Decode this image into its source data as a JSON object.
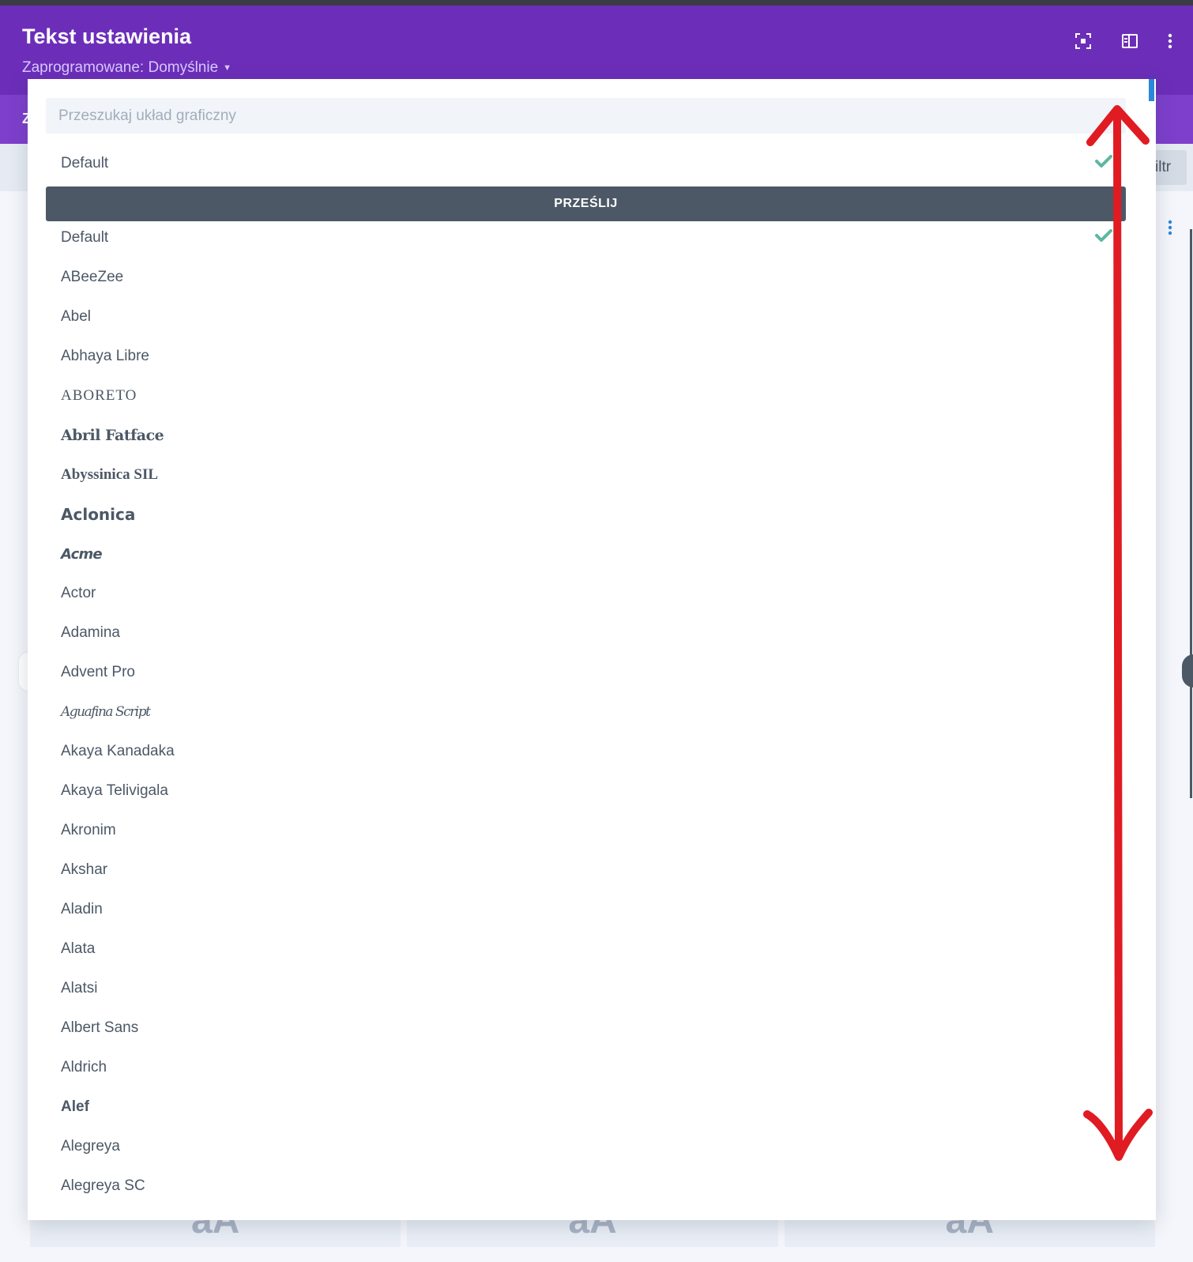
{
  "header": {
    "title": "Tekst ustawienia",
    "preset_label": "Zaprogramowane: Domyślnie",
    "colors": {
      "header_bg": "#6c2eb9",
      "tabs_bg": "#7d3fcc",
      "accent_check": "#5cb8a0",
      "annotation_red": "#e01b22"
    }
  },
  "tabs": {
    "first_initial": "Z"
  },
  "toolbar": {
    "filter_label_partial": "iltr",
    "icons": [
      "focus-icon",
      "split-layout-icon",
      "more-vertical-icon"
    ]
  },
  "dropdown": {
    "search_placeholder": "Przeszukaj układ graficzny",
    "selected_item": "Default",
    "upload_button_label": "PRZEŚLIJ",
    "fonts": [
      "Default",
      "ABeeZee",
      "Abel",
      "Abhaya Libre",
      "ABORETO",
      "Abril Fatface",
      "Abyssinica SIL",
      "Aclonica",
      "Acme",
      "Actor",
      "Adamina",
      "Advent Pro",
      "Aguafina Script",
      "Akaya Kanadaka",
      "Akaya Telivigala",
      "Akronim",
      "Akshar",
      "Aladin",
      "Alata",
      "Alatsi",
      "Albert Sans",
      "Aldrich",
      "Alef",
      "Alegreya",
      "Alegreya SC"
    ]
  },
  "background_cards": {
    "sample_text": "aA"
  }
}
